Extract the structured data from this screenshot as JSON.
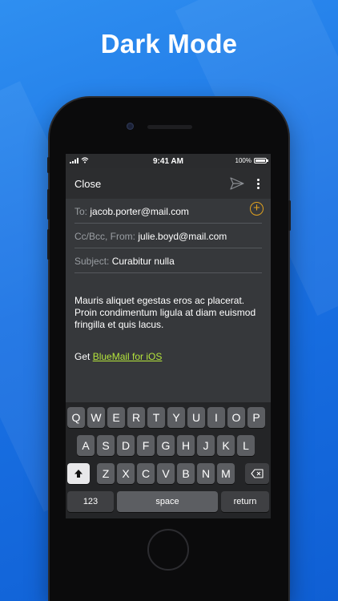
{
  "headline": "Dark Mode",
  "status_bar": {
    "time": "9:41 AM",
    "battery": "100%"
  },
  "toolbar": {
    "close_label": "Close"
  },
  "compose": {
    "to_label": "To:",
    "to_value": "jacob.porter@mail.com",
    "cc_label": "Cc/Bcc, From:",
    "cc_value": "julie.boyd@mail.com",
    "subject_label": "Subject:",
    "subject_value": "Curabitur nulla",
    "body": "Mauris aliquet egestas eros ac placerat. Proin condimentum ligula at diam euismod fringilla et quis lacus.",
    "signature_prefix": "Get ",
    "signature_link": "BlueMail for iOS"
  },
  "keyboard": {
    "row1": [
      "Q",
      "W",
      "E",
      "R",
      "T",
      "Y",
      "U",
      "I",
      "O",
      "P"
    ],
    "row2": [
      "A",
      "S",
      "D",
      "F",
      "G",
      "H",
      "J",
      "K",
      "L"
    ],
    "row3": [
      "Z",
      "X",
      "C",
      "V",
      "B",
      "N",
      "M"
    ],
    "numbers_label": "123",
    "space_label": "space",
    "return_label": "return"
  },
  "colors": {
    "accent": "#e1a21f",
    "link": "#b6e63c",
    "background": "#1a72e4"
  }
}
